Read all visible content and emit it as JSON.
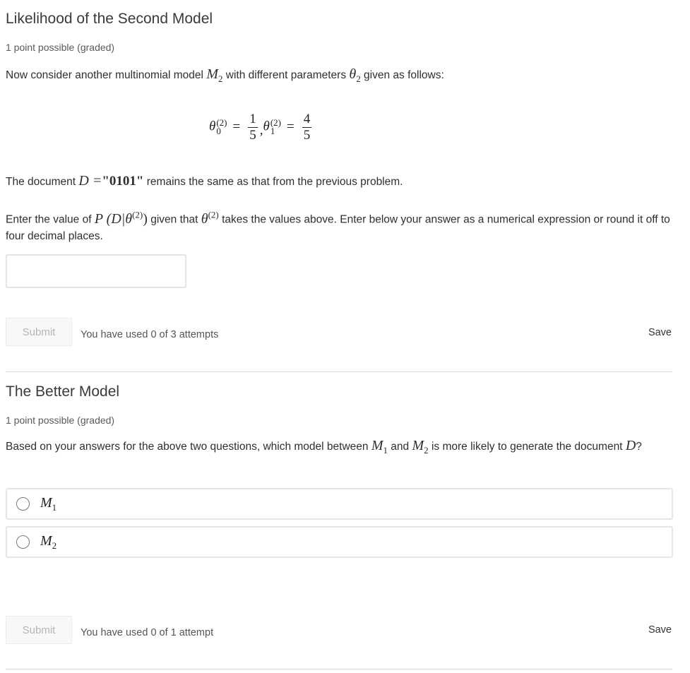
{
  "problem1": {
    "title": "Likelihood of the Second Model",
    "points": "1 point possible (graded)",
    "intro_before": "Now consider another multinomial model ",
    "intro_model": "M",
    "intro_model_sub": "2",
    "intro_middle": " with different parameters ",
    "intro_param": "θ",
    "intro_param_sub": "2",
    "intro_after": " given as follows:",
    "formula": {
      "theta0_symbol": "θ",
      "theta0_sup": "(2)",
      "theta0_sub": "0",
      "theta0_num": "1",
      "theta0_den": "5",
      "theta1_symbol": "θ",
      "theta1_sup": "(2)",
      "theta1_sub": "1",
      "theta1_num": "4",
      "theta1_den": "5",
      "equals": "=",
      "comma": ","
    },
    "doc_before": "The document ",
    "doc_var": "D",
    "doc_eq": " =",
    "doc_value": "\"0101\"",
    "doc_after": " remains the same as that from the previous problem.",
    "enter_before": "Enter the value of ",
    "enter_expr": "P (D|θ",
    "enter_expr_sup": "(2)",
    "enter_expr_close": ")",
    "enter_middle": " given that ",
    "enter_theta": "θ",
    "enter_theta_sup": "(2)",
    "enter_after": " takes the values above. Enter below your answer as a numerical expression or round it off to four decimal places.",
    "answer_value": "",
    "submit_label": "Submit",
    "attempts": "You have used 0 of 3 attempts",
    "save_label": "Save"
  },
  "problem2": {
    "title": "The Better Model",
    "points": "1 point possible (graded)",
    "q_before": "Based on your answers for the above two questions, which model between ",
    "q_m1": "M",
    "q_m1_sub": "1",
    "q_and": " and ",
    "q_m2": "M",
    "q_m2_sub": "2",
    "q_after": " is more likely to generate the document ",
    "q_doc": "D",
    "q_end": "?",
    "choices": [
      {
        "label": "M",
        "sub": "1",
        "selected": false
      },
      {
        "label": "M",
        "sub": "2",
        "selected": false
      }
    ],
    "submit_label": "Submit",
    "attempts": "You have used 0 of 1 attempt",
    "save_label": "Save"
  }
}
